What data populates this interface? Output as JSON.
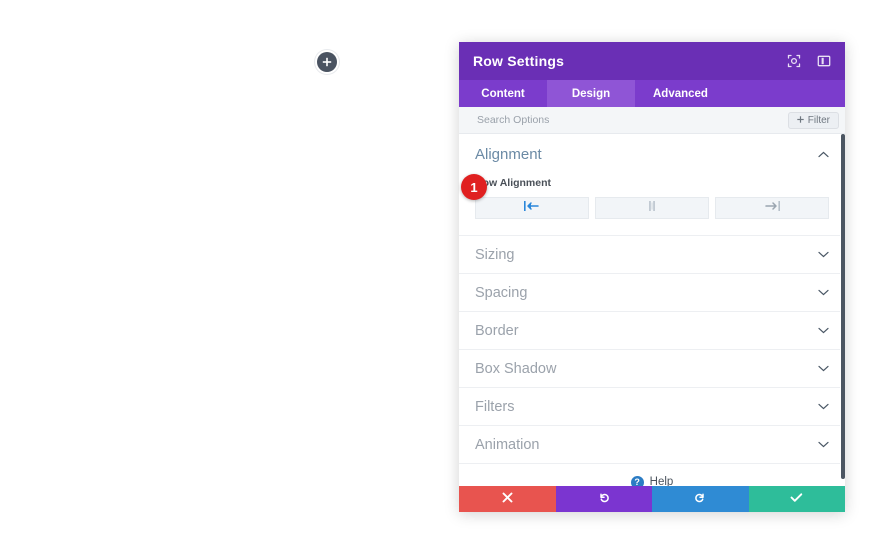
{
  "colors": {
    "header_purple": "#6a2fb5",
    "tabs_purple": "#7b3ccc",
    "active_tab_purple": "#8f55d6",
    "accent_blue": "#2b87da",
    "badge_red": "#e02020",
    "cancel_red": "#e8544f",
    "undo_purple": "#7b35d0",
    "redo_blue": "#2f8bd4",
    "save_green": "#2ebd9a",
    "section_title_blue": "#6b8aa5"
  },
  "canvas": {
    "add_row_icon": "plus-icon",
    "add_row_label": "+"
  },
  "panel": {
    "title": "Row Settings",
    "header_icons": [
      {
        "name": "focus-target-icon"
      },
      {
        "name": "panel-layout-icon"
      }
    ],
    "tabs": [
      {
        "label": "Content",
        "active": false
      },
      {
        "label": "Design",
        "active": true
      },
      {
        "label": "Advanced",
        "active": false
      }
    ],
    "search": {
      "placeholder": "Search Options",
      "value": "",
      "filter_label": "Filter",
      "filter_icon": "plus-icon"
    },
    "open_section": {
      "title": "Alignment",
      "chevron": "chevron-up-icon",
      "field_label": "Row Alignment",
      "options": [
        {
          "name": "align-left",
          "label": "Left",
          "icon": "align-left-icon",
          "selected": true
        },
        {
          "name": "align-center",
          "label": "Center",
          "icon": "align-center-icon",
          "selected": false
        },
        {
          "name": "align-right",
          "label": "Right",
          "icon": "align-right-icon",
          "selected": false
        }
      ]
    },
    "sections": [
      {
        "label": "Sizing",
        "chevron": "chevron-down-icon"
      },
      {
        "label": "Spacing",
        "chevron": "chevron-down-icon"
      },
      {
        "label": "Border",
        "chevron": "chevron-down-icon"
      },
      {
        "label": "Box Shadow",
        "chevron": "chevron-down-icon"
      },
      {
        "label": "Filters",
        "chevron": "chevron-down-icon"
      },
      {
        "label": "Animation",
        "chevron": "chevron-down-icon"
      }
    ],
    "help": {
      "label": "Help",
      "icon": "question-mark-icon",
      "icon_glyph": "?"
    },
    "actions": [
      {
        "name": "cancel-button",
        "icon": "close-x-icon",
        "color": "#e8544f"
      },
      {
        "name": "undo-button",
        "icon": "undo-arrow-icon",
        "color": "#7b35d0"
      },
      {
        "name": "redo-button",
        "icon": "redo-arrow-icon",
        "color": "#2f8bd4"
      },
      {
        "name": "save-button",
        "icon": "checkmark-icon",
        "color": "#2ebd9a"
      }
    ]
  },
  "annotation": {
    "step_number": "1"
  }
}
